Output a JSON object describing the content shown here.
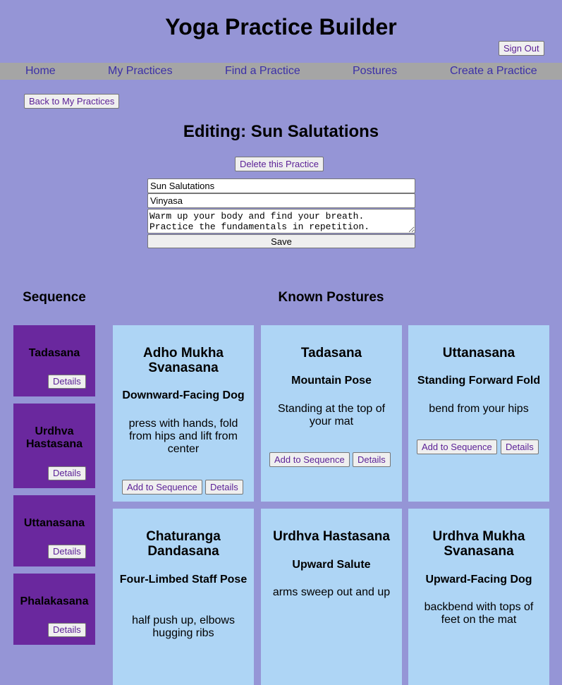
{
  "app": {
    "title": "Yoga Practice Builder",
    "sign_out_label": "Sign Out"
  },
  "nav": {
    "items": [
      {
        "label": "Home"
      },
      {
        "label": "My Practices"
      },
      {
        "label": "Find a Practice"
      },
      {
        "label": "Postures"
      },
      {
        "label": "Create a Practice"
      }
    ]
  },
  "editor": {
    "back_label": "Back to My Practices",
    "heading": "Editing: Sun Salutations",
    "delete_label": "Delete this Practice",
    "name_value": "Sun Salutations",
    "style_value": "Vinyasa",
    "description_value": "Warm up your body and find your breath.\nPractice the fundamentals in repetition.",
    "save_label": "Save"
  },
  "sequence": {
    "title": "Sequence",
    "details_label": "Details",
    "items": [
      {
        "name": "Tadasana"
      },
      {
        "name": "Urdhva Hastasana"
      },
      {
        "name": "Uttanasana"
      },
      {
        "name": "Phalakasana"
      }
    ]
  },
  "postures": {
    "title": "Known Postures",
    "add_label": "Add to Sequence",
    "details_label": "Details",
    "items": [
      {
        "sanskrit": "Adho Mukha Svanasana",
        "english": "Downward-Facing Dog",
        "description": "press with hands, fold from hips and lift from center"
      },
      {
        "sanskrit": "Tadasana",
        "english": "Mountain Pose",
        "description": "Standing at the top of your mat"
      },
      {
        "sanskrit": "Uttanasana",
        "english": "Standing Forward Fold",
        "description": "bend from your hips"
      },
      {
        "sanskrit": "Chaturanga Dandasana",
        "english": "Four-Limbed Staff Pose",
        "description": "half push up, elbows hugging ribs"
      },
      {
        "sanskrit": "Urdhva Hastasana",
        "english": "Upward Salute",
        "description": "arms sweep out and up"
      },
      {
        "sanskrit": "Urdhva Mukha Svanasana",
        "english": "Upward-Facing Dog",
        "description": "backbend with tops of feet on the mat"
      }
    ]
  }
}
